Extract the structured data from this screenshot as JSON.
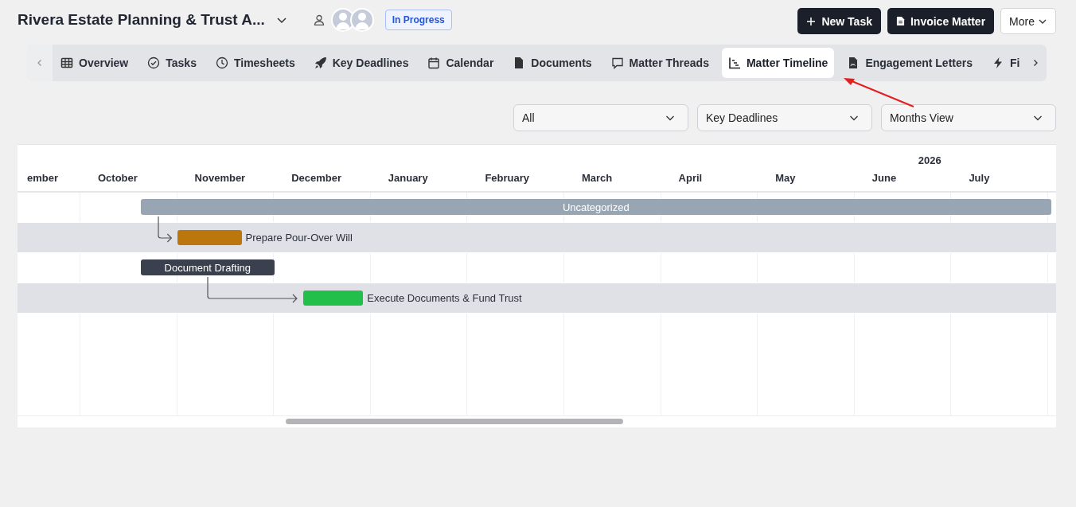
{
  "matter": {
    "title": "Rivera Estate Planning & Trust A...",
    "status": "In Progress"
  },
  "actions": [
    {
      "kind": "new",
      "label": "New Task"
    },
    {
      "kind": "invoice",
      "label": "Invoice Matter"
    },
    {
      "kind": "more",
      "label": "More"
    }
  ],
  "tabs": [
    {
      "label": "Overview",
      "selected": false
    },
    {
      "label": "Tasks",
      "selected": false
    },
    {
      "label": "Timesheets",
      "selected": false
    },
    {
      "label": "Key Deadlines",
      "selected": false
    },
    {
      "label": "Calendar",
      "selected": false
    },
    {
      "label": "Documents",
      "selected": false
    },
    {
      "label": "Matter Threads",
      "selected": false
    },
    {
      "label": "Matter Timeline",
      "selected": true
    },
    {
      "label": "Engagement Letters",
      "selected": false
    },
    {
      "label": "Fi",
      "selected": false
    }
  ],
  "filters": [
    {
      "value": "All"
    },
    {
      "value": "Key Deadlines"
    },
    {
      "value": "Months View"
    }
  ],
  "timeline": {
    "year": "2026",
    "months": [
      {
        "label": "ember"
      },
      {
        "label": "October"
      },
      {
        "label": "November"
      },
      {
        "label": "December"
      },
      {
        "label": "January"
      },
      {
        "label": "February"
      },
      {
        "label": "March"
      },
      {
        "label": "April"
      },
      {
        "label": "May"
      },
      {
        "label": "June"
      },
      {
        "label": "July"
      }
    ],
    "rows": [
      {
        "kind": "group",
        "label": "Uncategorized"
      },
      {
        "kind": "task",
        "label": "Prepare Pour-Over Will",
        "color": "#bb770b"
      },
      {
        "kind": "phase",
        "label": "Document Drafting"
      },
      {
        "kind": "task",
        "label": "Execute Documents & Fund Trust",
        "color": "#22c04b"
      }
    ]
  }
}
